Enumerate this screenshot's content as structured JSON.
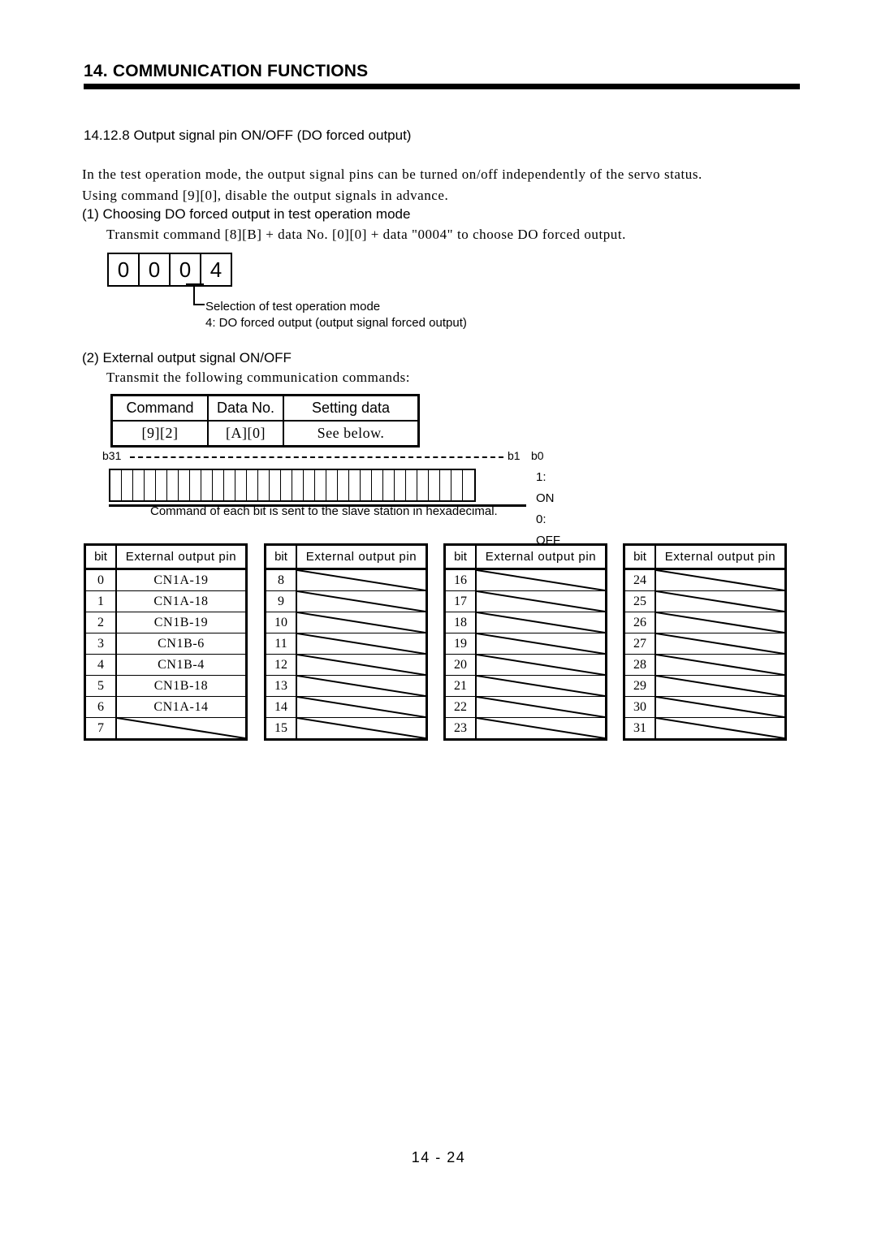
{
  "header": {
    "chapter_title": "14. COMMUNICATION FUNCTIONS"
  },
  "section": {
    "heading": "14.12.8 Output signal pin ON/OFF (DO forced output)",
    "intro_line1": "In the test operation mode, the output signal pins can be turned on/off independently of the servo status.",
    "intro_line2": "Using command [9][0], disable the output signals in advance."
  },
  "part1": {
    "item_label": "(1) Choosing DO forced output in test operation mode",
    "transmit_text": "Transmit command [8][B] + data No. [0][0] + data \"0004\" to choose DO forced output.",
    "digits": [
      "0",
      "0",
      "0",
      "4"
    ],
    "leader_line1": "Selection of test operation mode",
    "leader_line2": "4: DO forced output (output signal forced output)"
  },
  "part2": {
    "item_label": "(2) External output signal ON/OFF",
    "transmit_text": "Transmit the following communication commands:",
    "command_table": {
      "headers": [
        "Command",
        "Data No.",
        "Setting data"
      ],
      "values": [
        "[9][2]",
        "[A][0]",
        "See below."
      ]
    },
    "bit_strip": {
      "left_label": "b31",
      "mid_label": "b1",
      "right_label": "b0",
      "cell_count": 32,
      "legend_on": "1: ON",
      "legend_off": "0: OFF",
      "note": "Command of each bit is sent to the slave station in hexadecimal."
    }
  },
  "bit_tables": {
    "headers": [
      "bit",
      "External output pin"
    ],
    "columns": [
      {
        "rows": [
          {
            "bit": "0",
            "pin": "CN1A-19",
            "empty": false
          },
          {
            "bit": "1",
            "pin": "CN1A-18",
            "empty": false
          },
          {
            "bit": "2",
            "pin": "CN1B-19",
            "empty": false
          },
          {
            "bit": "3",
            "pin": "CN1B-6",
            "empty": false
          },
          {
            "bit": "4",
            "pin": "CN1B-4",
            "empty": false
          },
          {
            "bit": "5",
            "pin": "CN1B-18",
            "empty": false
          },
          {
            "bit": "6",
            "pin": "CN1A-14",
            "empty": false
          },
          {
            "bit": "7",
            "pin": "",
            "empty": true
          }
        ]
      },
      {
        "rows": [
          {
            "bit": "8",
            "pin": "",
            "empty": true
          },
          {
            "bit": "9",
            "pin": "",
            "empty": true
          },
          {
            "bit": "10",
            "pin": "",
            "empty": true
          },
          {
            "bit": "11",
            "pin": "",
            "empty": true
          },
          {
            "bit": "12",
            "pin": "",
            "empty": true
          },
          {
            "bit": "13",
            "pin": "",
            "empty": true
          },
          {
            "bit": "14",
            "pin": "",
            "empty": true
          },
          {
            "bit": "15",
            "pin": "",
            "empty": true
          }
        ]
      },
      {
        "rows": [
          {
            "bit": "16",
            "pin": "",
            "empty": true
          },
          {
            "bit": "17",
            "pin": "",
            "empty": true
          },
          {
            "bit": "18",
            "pin": "",
            "empty": true
          },
          {
            "bit": "19",
            "pin": "",
            "empty": true
          },
          {
            "bit": "20",
            "pin": "",
            "empty": true
          },
          {
            "bit": "21",
            "pin": "",
            "empty": true
          },
          {
            "bit": "22",
            "pin": "",
            "empty": true
          },
          {
            "bit": "23",
            "pin": "",
            "empty": true
          }
        ]
      },
      {
        "rows": [
          {
            "bit": "24",
            "pin": "",
            "empty": true
          },
          {
            "bit": "25",
            "pin": "",
            "empty": true
          },
          {
            "bit": "26",
            "pin": "",
            "empty": true
          },
          {
            "bit": "27",
            "pin": "",
            "empty": true
          },
          {
            "bit": "28",
            "pin": "",
            "empty": true
          },
          {
            "bit": "29",
            "pin": "",
            "empty": true
          },
          {
            "bit": "30",
            "pin": "",
            "empty": true
          },
          {
            "bit": "31",
            "pin": "",
            "empty": true
          }
        ]
      }
    ]
  },
  "footer": {
    "page_number": "14 -  24"
  }
}
